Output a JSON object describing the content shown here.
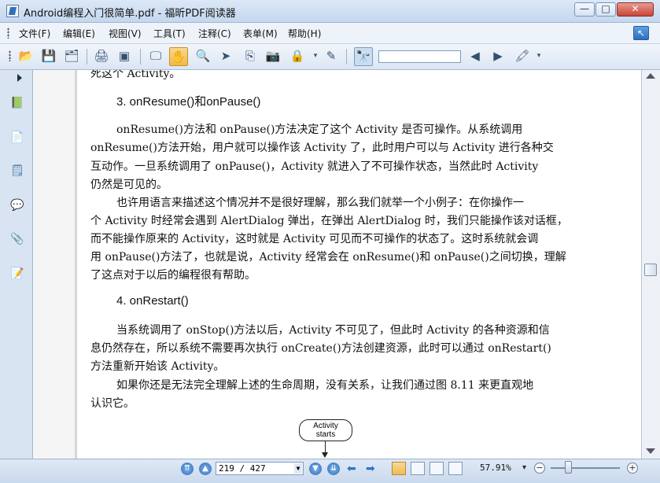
{
  "window": {
    "title": "Android编程入门很简单.pdf - 福昕PDF阅读器",
    "min": "—",
    "max": "□",
    "close": "✕"
  },
  "menu": {
    "items": [
      "文件(F)",
      "编辑(E)",
      "视图(V)",
      "工具(T)",
      "注释(C)",
      "表单(M)",
      "帮助(H)"
    ]
  },
  "toolbar": {
    "icons": [
      "open-icon",
      "save-icon",
      "save-as-icon",
      "print-icon",
      "scan-icon",
      "fullscreen-icon",
      "hand-icon",
      "zoom-icon",
      "select-icon",
      "text-icon",
      "snapshot-icon",
      "rms-icon",
      "sign-icon",
      "binoculars-icon",
      "prev-result-icon",
      "next-result-icon",
      "highlight-icon"
    ],
    "search": {
      "placeholder": ""
    }
  },
  "status": {
    "page": "219 / 427",
    "zoom": "57.91%"
  },
  "document": {
    "top": "死这个 Activity。",
    "heading3": "3. onResume()和onPause()",
    "p1": [
      "onResume()方法和  onPause()方法决定了这个  Activity  是否可操作。从系统调用",
      "onResume()方法开始，用户就可以操作该 Activity 了，此时用户可以与 Activity 进行各种交",
      "互动作。一旦系统调用了  onPause()，Activity  就进入了不可操作状态，当然此时  Activity",
      "仍然是可见的。"
    ],
    "p2": [
      "也许用语言来描述这个情况并不是很好理解，那么我们就举一个小例子：在你操作一",
      "个 Activity 时经常会遇到 AlertDialog 弹出，在弹出 AlertDialog 时，我们只能操作该对话框，",
      "而不能操作原来的 Activity，这时就是 Activity 可见而不可操作的状态了。这时系统就会调",
      "用 onPause()方法了，也就是说，Activity 经常会在 onResume()和 onPause()之间切换，理解",
      "了这点对于以后的编程很有帮助。"
    ],
    "heading4": "4. onRestart()",
    "p3": [
      "当系统调用了 onStop()方法以后，Activity 不可见了，但此时 Activity 的各种资源和信",
      "息仍然存在，所以系统不需要再次执行 onCreate()方法创建资源，此时可以通过 onRestart()",
      "方法重新开始该 Activity。"
    ],
    "p4": [
      "如果你还是无法完全理解上述的生命周期，没有关系，让我们通过图 8.11 来更直观地",
      "认识它。"
    ],
    "diagram": {
      "line1": "Activity",
      "line2": "starts"
    }
  }
}
